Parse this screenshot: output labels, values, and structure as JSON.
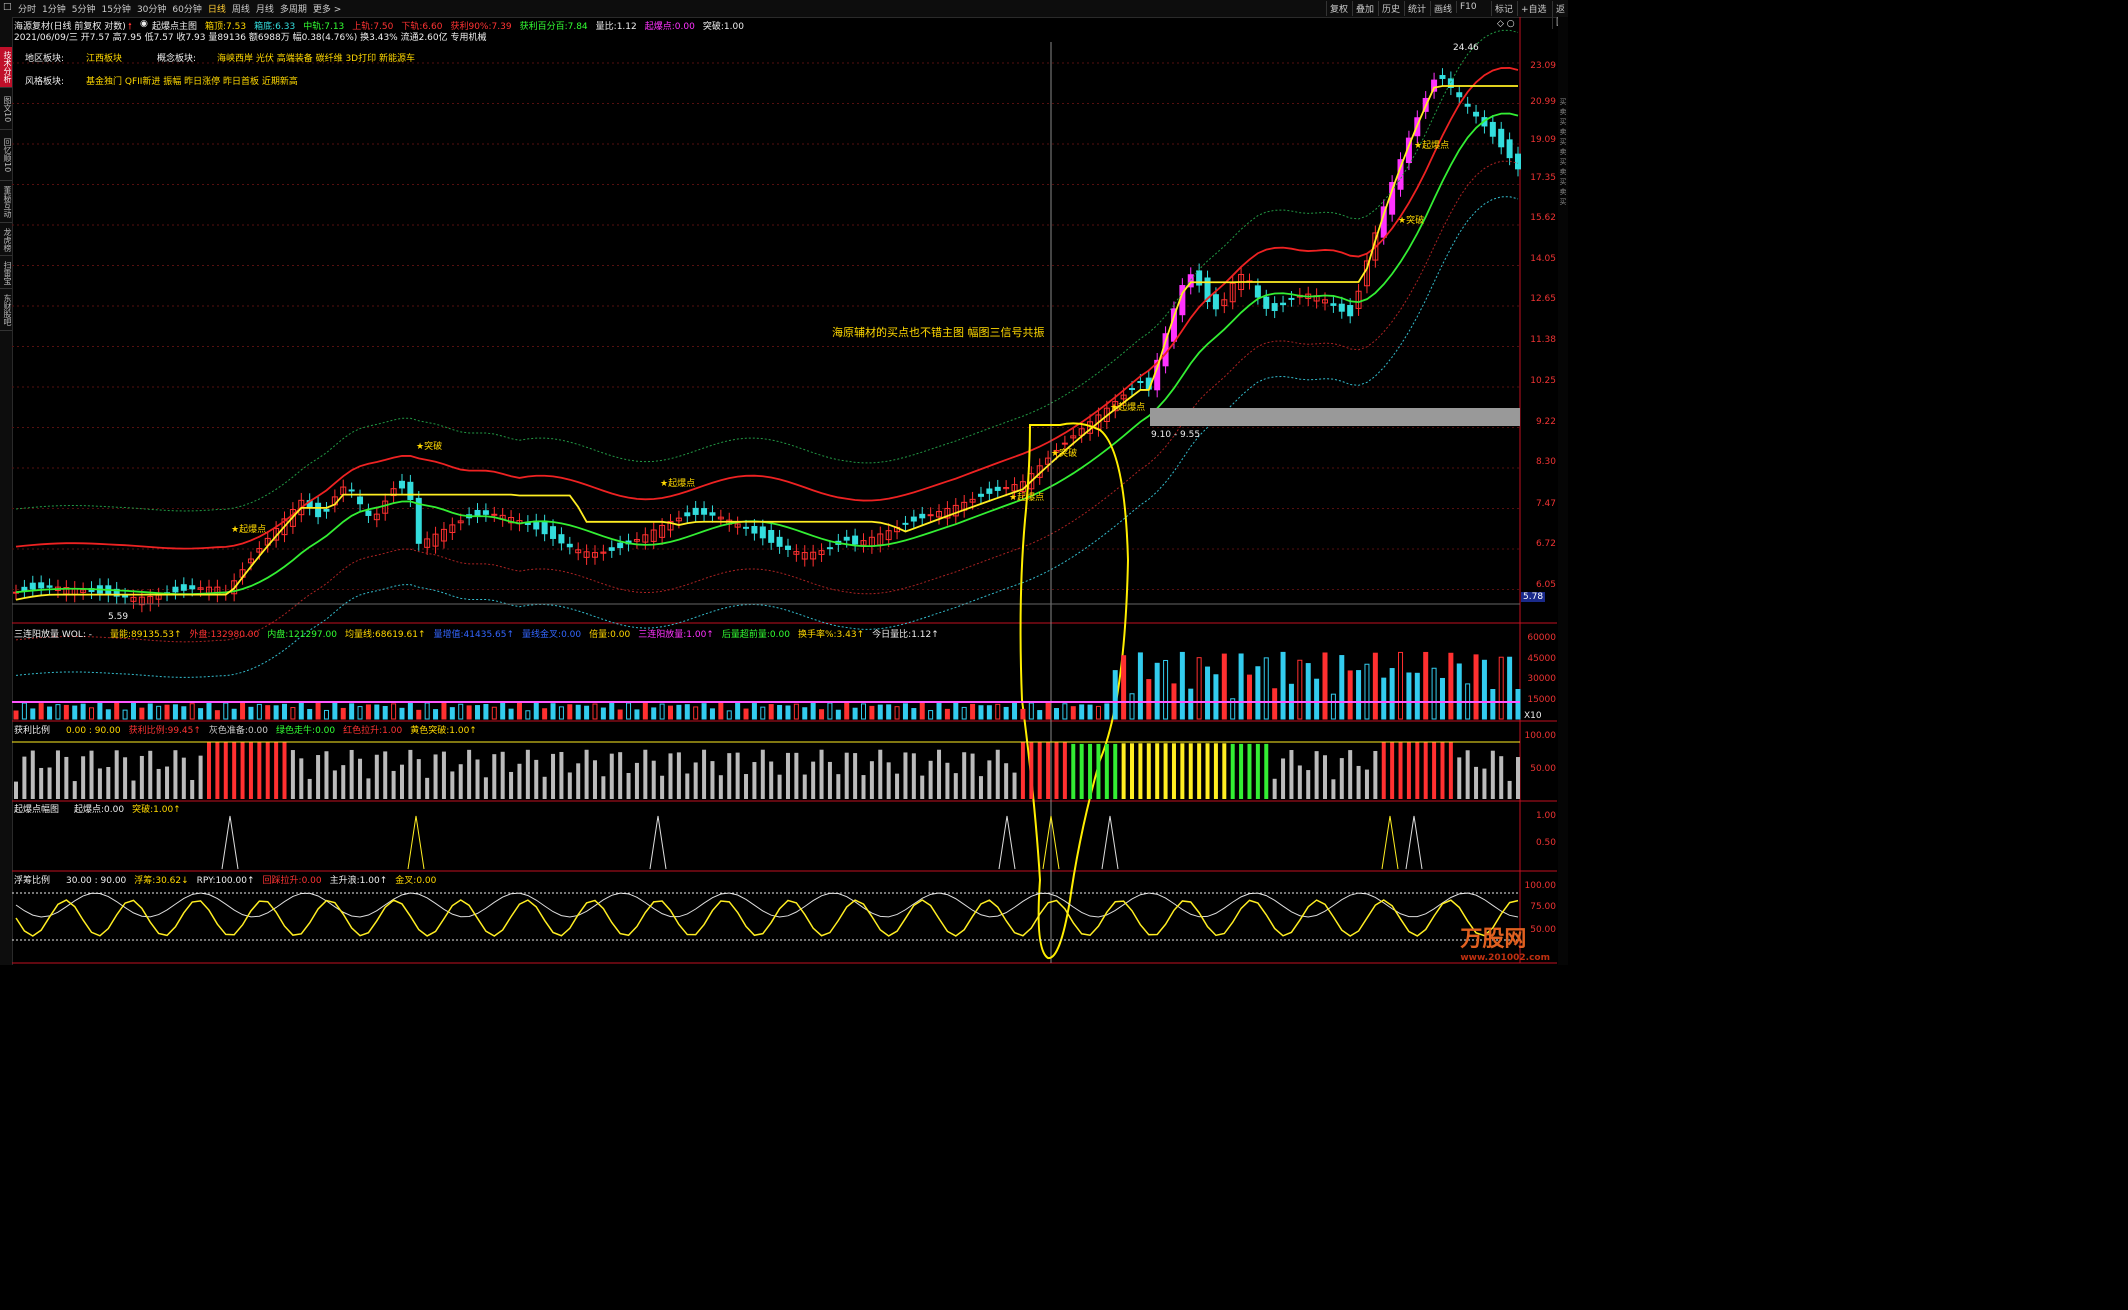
{
  "toolbar": {
    "icon_text": "",
    "periods": [
      "分时",
      "1分钟",
      "5分钟",
      "15分钟",
      "30分钟",
      "60分钟",
      "日线",
      "周线",
      "月线",
      "多周期",
      "更多 >"
    ],
    "active_period": "日线",
    "right_buttons": [
      "复权",
      "叠加",
      "历史",
      "统计",
      "画线",
      "F10",
      "标记",
      "+自选",
      "返回"
    ]
  },
  "left_tabs": [
    {
      "label": "技术分析",
      "active": true
    },
    {
      "label": "图文10",
      "active": false
    },
    {
      "label": "回忆顺10",
      "active": false
    },
    {
      "label": "董秘互动",
      "active": false
    },
    {
      "label": "龙虎榜",
      "active": false
    },
    {
      "label": "扫雷宝",
      "active": false
    },
    {
      "label": "东财股吧",
      "active": false
    }
  ],
  "top_right_vertical": "分时走势",
  "stock_header": {
    "name": "海源复材(日线 前复权 对数)",
    "indicator_name": "起爆点主图",
    "fields": [
      {
        "label": "箱顶:",
        "value": "7.53",
        "color": "#ffd800"
      },
      {
        "label": "箱底:",
        "value": "6.33",
        "color": "#33dddd"
      },
      {
        "label": "中轨:",
        "value": "7.13",
        "color": "#33ff33"
      },
      {
        "label": "上轨:",
        "value": "7.50",
        "color": "#ff3333"
      },
      {
        "label": "下轨:",
        "value": "6.60",
        "color": "#ff3333"
      },
      {
        "label": "获利90%:",
        "value": "7.39",
        "color": "#ff3333"
      },
      {
        "label": "获利百分百:",
        "value": "7.84",
        "color": "#33ff33"
      },
      {
        "label": "量比:",
        "value": "1.12",
        "color": "#eeeeee"
      },
      {
        "label": "起爆点:",
        "value": "0.00",
        "color": "#ff33ff"
      },
      {
        "label": "突破:",
        "value": "1.00",
        "color": "#eeeeee"
      }
    ],
    "quote_line": "2021/06/09/三 开7.57 高7.95 低7.57 收7.93 量89136 额6988万 幅0.38(4.76%) 换3.43% 流通2.60亿 专用机械"
  },
  "sector": {
    "region_label": "地区板块:",
    "region_value": "江西板块",
    "concept_label": "概念板块:",
    "concept_value": "海峡西岸 光伏 高端装备 碳纤维 3D打印 新能源车",
    "style_label": "风格板块:",
    "style_value": "基金独门 QFII新进 振幅 昨日涨停 昨日首板 近期新高"
  },
  "annotation": "海原辅材的买点也不错主图 幅图三信号共振",
  "chart_labels": {
    "breakout": "★突破",
    "ignite": "★起爆点",
    "box_range": "9.10 - 9.55",
    "peak": "24.46",
    "low": "5.59",
    "current_price_tag": "5.78"
  },
  "price_axis": [
    "23.09",
    "20.99",
    "19.09",
    "17.35",
    "15.62",
    "14.05",
    "12.65",
    "11.38",
    "10.25",
    "9.22",
    "8.30",
    "7.47",
    "6.72",
    "6.05"
  ],
  "volume_panel": {
    "title": "三连阳放量 WOL: -",
    "fields": [
      {
        "label": "量能:",
        "value": "89135.53↑",
        "color": "#ffd800"
      },
      {
        "label": "外盘:",
        "value": "132980.00",
        "color": "#ff3333"
      },
      {
        "label": "内盘:",
        "value": "121297.00",
        "color": "#33ff33"
      },
      {
        "label": "均量线:",
        "value": "68619.61↑",
        "color": "#ffd800"
      },
      {
        "label": "量增值:",
        "value": "41435.65↑",
        "color": "#3366ff"
      },
      {
        "label": "量线金叉:",
        "value": "0.00",
        "color": "#3366ff"
      },
      {
        "label": "倍量:",
        "value": "0.00",
        "color": "#ffd800"
      },
      {
        "label": "三连阳放量:",
        "value": "1.00↑",
        "color": "#ff33ff"
      },
      {
        "label": "后量超前量:",
        "value": "0.00",
        "color": "#33ff33"
      },
      {
        "label": "换手率%:",
        "value": "3.43↑",
        "color": "#ffd800"
      },
      {
        "label": "今日量比:",
        "value": "1.12↑",
        "color": "#eeeeee"
      }
    ],
    "axis": [
      "60000",
      "45000",
      "30000",
      "15000"
    ],
    "unit": "X10"
  },
  "profit_panel": {
    "title": "获利比例",
    "fields": [
      {
        "label": "",
        "value": "0.00 : 90.00",
        "color": "#ffd800"
      },
      {
        "label": "获利比例:",
        "value": "99.45↑",
        "color": "#ff3333"
      },
      {
        "label": "灰色准备:",
        "value": "0.00",
        "color": "#cccccc"
      },
      {
        "label": "绿色走牛:",
        "value": "0.00",
        "color": "#33ff33"
      },
      {
        "label": "红色拉升:",
        "value": "1.00",
        "color": "#ff3333"
      },
      {
        "label": "黄色突破:",
        "value": "1.00↑",
        "color": "#ffd800"
      }
    ],
    "axis": [
      "100.00",
      "50.00"
    ]
  },
  "ignite_panel": {
    "title": "起爆点幅图",
    "fields": [
      {
        "label": "起爆点:",
        "value": "0.00",
        "color": "#eeeeee"
      },
      {
        "label": "突破:",
        "value": "1.00↑",
        "color": "#ffd800"
      }
    ],
    "axis": [
      "1.00",
      "0.50"
    ]
  },
  "float_panel": {
    "title": "浮筹比例",
    "fields": [
      {
        "label": "",
        "value": "30.00 : 90.00",
        "color": "#eeeeee"
      },
      {
        "label": "浮筹:",
        "value": "30.62↓",
        "color": "#ffd800"
      },
      {
        "label": "RPY:",
        "value": "100.00↑",
        "color": "#eeeeee"
      },
      {
        "label": "回踩拉升:",
        "value": "0.00",
        "color": "#ff3333"
      },
      {
        "label": "主升浪:",
        "value": "1.00↑",
        "color": "#eeeeee"
      },
      {
        "label": "金叉:",
        "value": "0.00",
        "color": "#ffd800"
      }
    ],
    "axis": [
      "100.00",
      "75.00",
      "50.00"
    ]
  },
  "watermark": {
    "text": "万股网",
    "sub": "www.201002.com"
  }
}
